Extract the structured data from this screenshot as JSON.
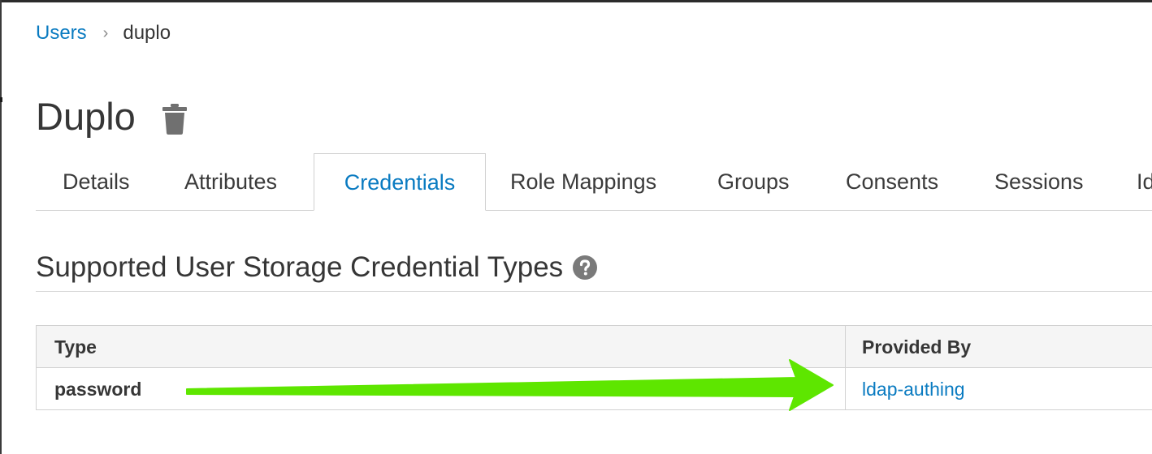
{
  "breadcrumb": {
    "parent": "Users",
    "separator": "›",
    "current": "duplo"
  },
  "header": {
    "title": "Duplo",
    "delete_icon": "trash-icon"
  },
  "tabs": [
    {
      "label": "Details",
      "active": false
    },
    {
      "label": "Attributes",
      "active": false
    },
    {
      "label": "Credentials",
      "active": true
    },
    {
      "label": "Role Mappings",
      "active": false
    },
    {
      "label": "Groups",
      "active": false
    },
    {
      "label": "Consents",
      "active": false
    },
    {
      "label": "Sessions",
      "active": false
    },
    {
      "label": "Id",
      "active": false
    }
  ],
  "section": {
    "heading": "Supported User Storage Credential Types",
    "help_icon": "question-circle-icon"
  },
  "table": {
    "columns": [
      "Type",
      "Provided By"
    ],
    "rows": [
      {
        "type": "password",
        "provided_by": "ldap-authing"
      }
    ]
  },
  "annotation": {
    "arrow_icon": "green-arrow-icon",
    "color": "#5ee600"
  },
  "colors": {
    "link": "#0a7bc1",
    "text": "#363636",
    "header_bg": "#f5f5f5",
    "border": "#d1d1d1"
  }
}
